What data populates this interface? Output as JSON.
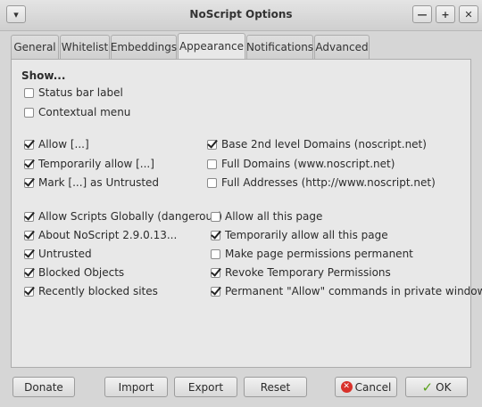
{
  "window": {
    "title": "NoScript Options",
    "menu_glyph": "▾",
    "minimize_glyph": "—",
    "maximize_glyph": "+",
    "close_glyph": "✕"
  },
  "tabs": [
    {
      "label": "General"
    },
    {
      "label": "Whitelist"
    },
    {
      "label": "Embeddings"
    },
    {
      "label": "Appearance",
      "active": true
    },
    {
      "label": "Notifications"
    },
    {
      "label": "Advanced"
    }
  ],
  "appearance": {
    "show_heading": "Show...",
    "status_bar_label": {
      "label": "Status bar label",
      "checked": false
    },
    "contextual_menu": {
      "label": "Contextual menu",
      "checked": false
    },
    "allow": {
      "label": "Allow [...]",
      "checked": true
    },
    "temporarily_allow": {
      "label": "Temporarily allow [...]",
      "checked": true
    },
    "mark_untrusted": {
      "label": "Mark [...] as Untrusted",
      "checked": true
    },
    "base_2nd_level_domains": {
      "label": "Base 2nd level Domains (noscript.net)",
      "checked": true
    },
    "full_domains": {
      "label": "Full Domains (www.noscript.net)",
      "checked": false
    },
    "full_addresses": {
      "label": "Full Addresses (http://www.noscript.net)",
      "checked": false
    },
    "allow_scripts_globally": {
      "label": "Allow Scripts Globally (dangerous)",
      "checked": true
    },
    "about_noscript": {
      "label": "About NoScript 2.9.0.13...",
      "checked": true
    },
    "untrusted": {
      "label": "Untrusted",
      "checked": true
    },
    "blocked_objects": {
      "label": "Blocked Objects",
      "checked": true
    },
    "recently_blocked_sites": {
      "label": "Recently blocked sites",
      "checked": true
    },
    "allow_all_this_page": {
      "label": "Allow all this page",
      "checked": false
    },
    "temporarily_allow_all_this_page": {
      "label": "Temporarily allow all this page",
      "checked": true
    },
    "make_page_permissions_permanent": {
      "label": "Make page permissions permanent",
      "checked": false
    },
    "revoke_temporary_permissions": {
      "label": "Revoke Temporary Permissions",
      "checked": true
    },
    "permanent_allow_private": {
      "label": "Permanent \"Allow\" commands in private windows",
      "checked": true
    }
  },
  "buttons": {
    "donate": "Donate",
    "import": "Import",
    "export": "Export",
    "reset": "Reset",
    "cancel": "Cancel",
    "ok": "OK"
  }
}
